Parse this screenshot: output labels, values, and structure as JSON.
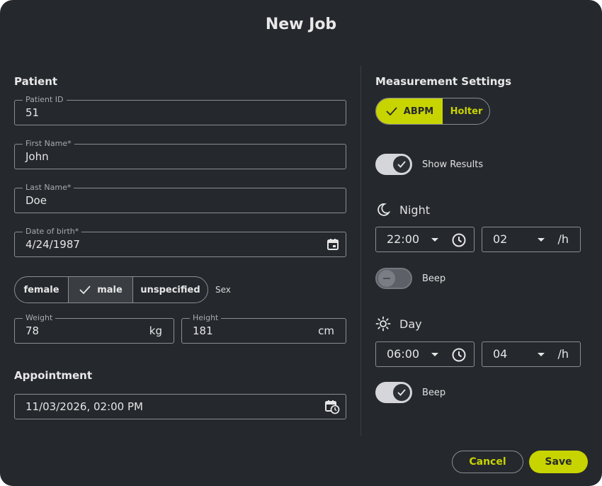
{
  "dialog": {
    "title": "New Job"
  },
  "patient": {
    "section_title": "Patient",
    "patient_id": {
      "label": "Patient ID",
      "value": "51"
    },
    "first_name": {
      "label": "First Name*",
      "value": "John"
    },
    "last_name": {
      "label": "Last Name*",
      "value": "Doe"
    },
    "dob": {
      "label": "Date of birth*",
      "value": "4/24/1987",
      "icon": "calendar-icon"
    },
    "sex": {
      "label": "Sex",
      "options": [
        "female",
        "male",
        "unspecified"
      ],
      "selected": "male"
    },
    "weight": {
      "label": "Weight",
      "value": "78",
      "unit": "kg"
    },
    "height": {
      "label": "Height",
      "value": "181",
      "unit": "cm"
    }
  },
  "appointment": {
    "section_title": "Appointment",
    "value": "11/03/2026, 02:00 PM",
    "icon": "calendar-clock-icon"
  },
  "measurement": {
    "section_title": "Measurement Settings",
    "modes": [
      "ABPM",
      "Holter"
    ],
    "selected_mode": "ABPM",
    "show_results": {
      "label": "Show Results",
      "on": true
    },
    "night": {
      "label": "Night",
      "icon": "moon-icon",
      "time": "22:00",
      "interval": "02",
      "interval_unit": "/h",
      "beep": {
        "label": "Beep",
        "on": false
      }
    },
    "day": {
      "label": "Day",
      "icon": "sun-icon",
      "time": "06:00",
      "interval": "04",
      "interval_unit": "/h",
      "beep": {
        "label": "Beep",
        "on": true
      }
    }
  },
  "actions": {
    "cancel": "Cancel",
    "save": "Save"
  },
  "colors": {
    "accent": "#c8d400",
    "background": "#25282d",
    "border": "#8a8d92"
  }
}
